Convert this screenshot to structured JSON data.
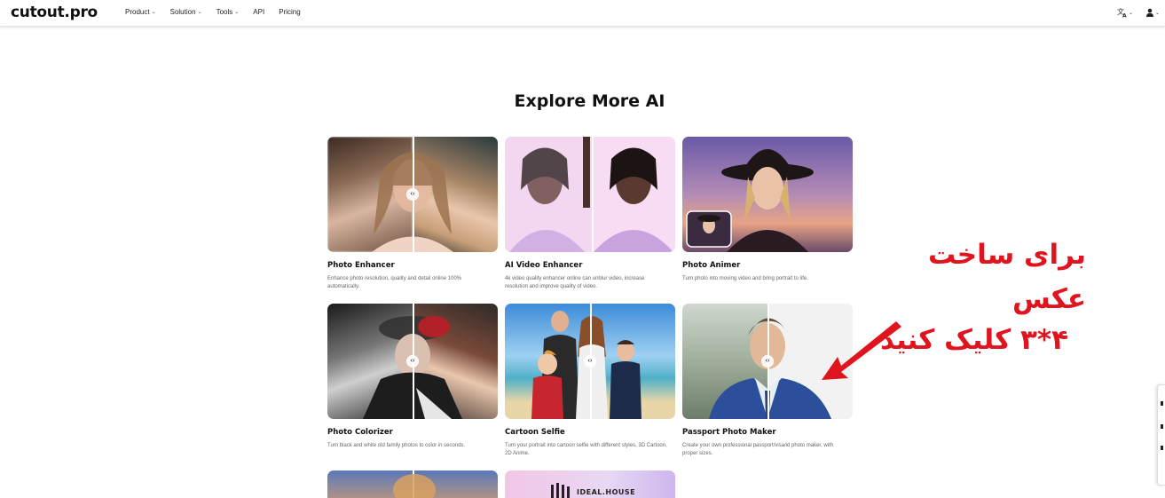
{
  "header": {
    "logo": "cutout.pro",
    "nav": [
      {
        "label": "Product",
        "has_dropdown": true
      },
      {
        "label": "Solution",
        "has_dropdown": true
      },
      {
        "label": "Tools",
        "has_dropdown": true
      },
      {
        "label": "API",
        "has_dropdown": false
      },
      {
        "label": "Pricing",
        "has_dropdown": false
      }
    ],
    "icons": [
      "translate-icon",
      "user-icon"
    ]
  },
  "section": {
    "title": "Explore More AI"
  },
  "cards": [
    {
      "title": "Photo Enhancer",
      "desc": "Enhance photo resolution, quality and detail online 100% automatically."
    },
    {
      "title": "AI Video Enhancer",
      "desc": "4k video quality enhancer online can unblur video, increase resolution and improve quality of video."
    },
    {
      "title": "Photo Animer",
      "desc": "Turn photo into moving video and bring portrait to life."
    },
    {
      "title": "Photo Colorizer",
      "desc": "Turn black and white old family photos to color in seconds."
    },
    {
      "title": "Cartoon Selfie",
      "desc": "Turn your portrait into cartoon selfie with different styles, 3D Cartoon, 2D Anime."
    },
    {
      "title": "Passport Photo Maker",
      "desc": "Create your own professional passport/visa/id photo maker, with proper sizes."
    }
  ],
  "partial_card_text": "IDEAL.HOUSE",
  "annotation": {
    "line1": "برای ساخت عکس",
    "line2": "۴*۳ کلیک کنید",
    "color": "#e0141e"
  }
}
